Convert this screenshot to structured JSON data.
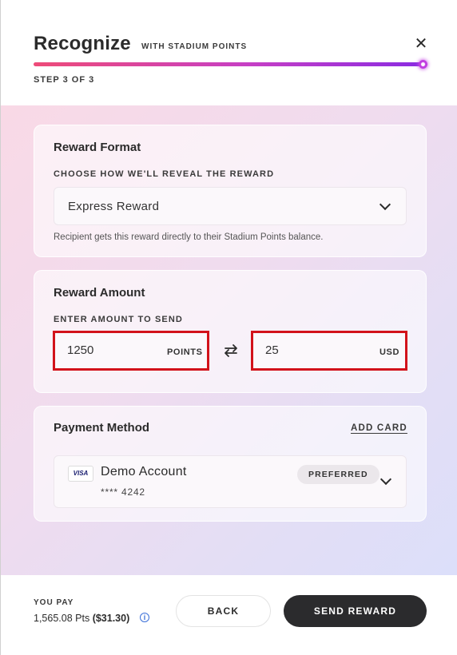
{
  "header": {
    "title": "Recognize",
    "subtitle": "WITH STADIUM POINTS",
    "close_icon": "close-icon",
    "step_text": "STEP 3 OF 3",
    "progress_fraction": 1.0,
    "progress_colors": [
      "#ee4b78",
      "#c63fc5",
      "#8a2be2"
    ]
  },
  "reward_format": {
    "title": "Reward Format",
    "label": "CHOOSE HOW WE'LL REVEAL THE REWARD",
    "selected": "Express Reward",
    "helper": "Recipient gets this reward directly to their Stadium Points balance."
  },
  "reward_amount": {
    "title": "Reward Amount",
    "label": "ENTER AMOUNT TO SEND",
    "points_value": "1250",
    "points_unit": "POINTS",
    "usd_value": "25",
    "usd_unit": "USD",
    "swap_icon": "swap-arrows-icon",
    "highlight_color": "#d2121a"
  },
  "payment_method": {
    "title": "Payment Method",
    "add_card": "ADD CARD",
    "card_brand": "VISA",
    "account_name": "Demo Account",
    "account_number": "**** 4242",
    "badge": "PREFERRED"
  },
  "footer": {
    "you_pay_label": "YOU PAY",
    "you_pay_pts": "1,565.08 Pts",
    "you_pay_usd": "($31.30)",
    "info_icon": "info-icon",
    "back_label": "BACK",
    "send_label": "SEND REWARD"
  }
}
